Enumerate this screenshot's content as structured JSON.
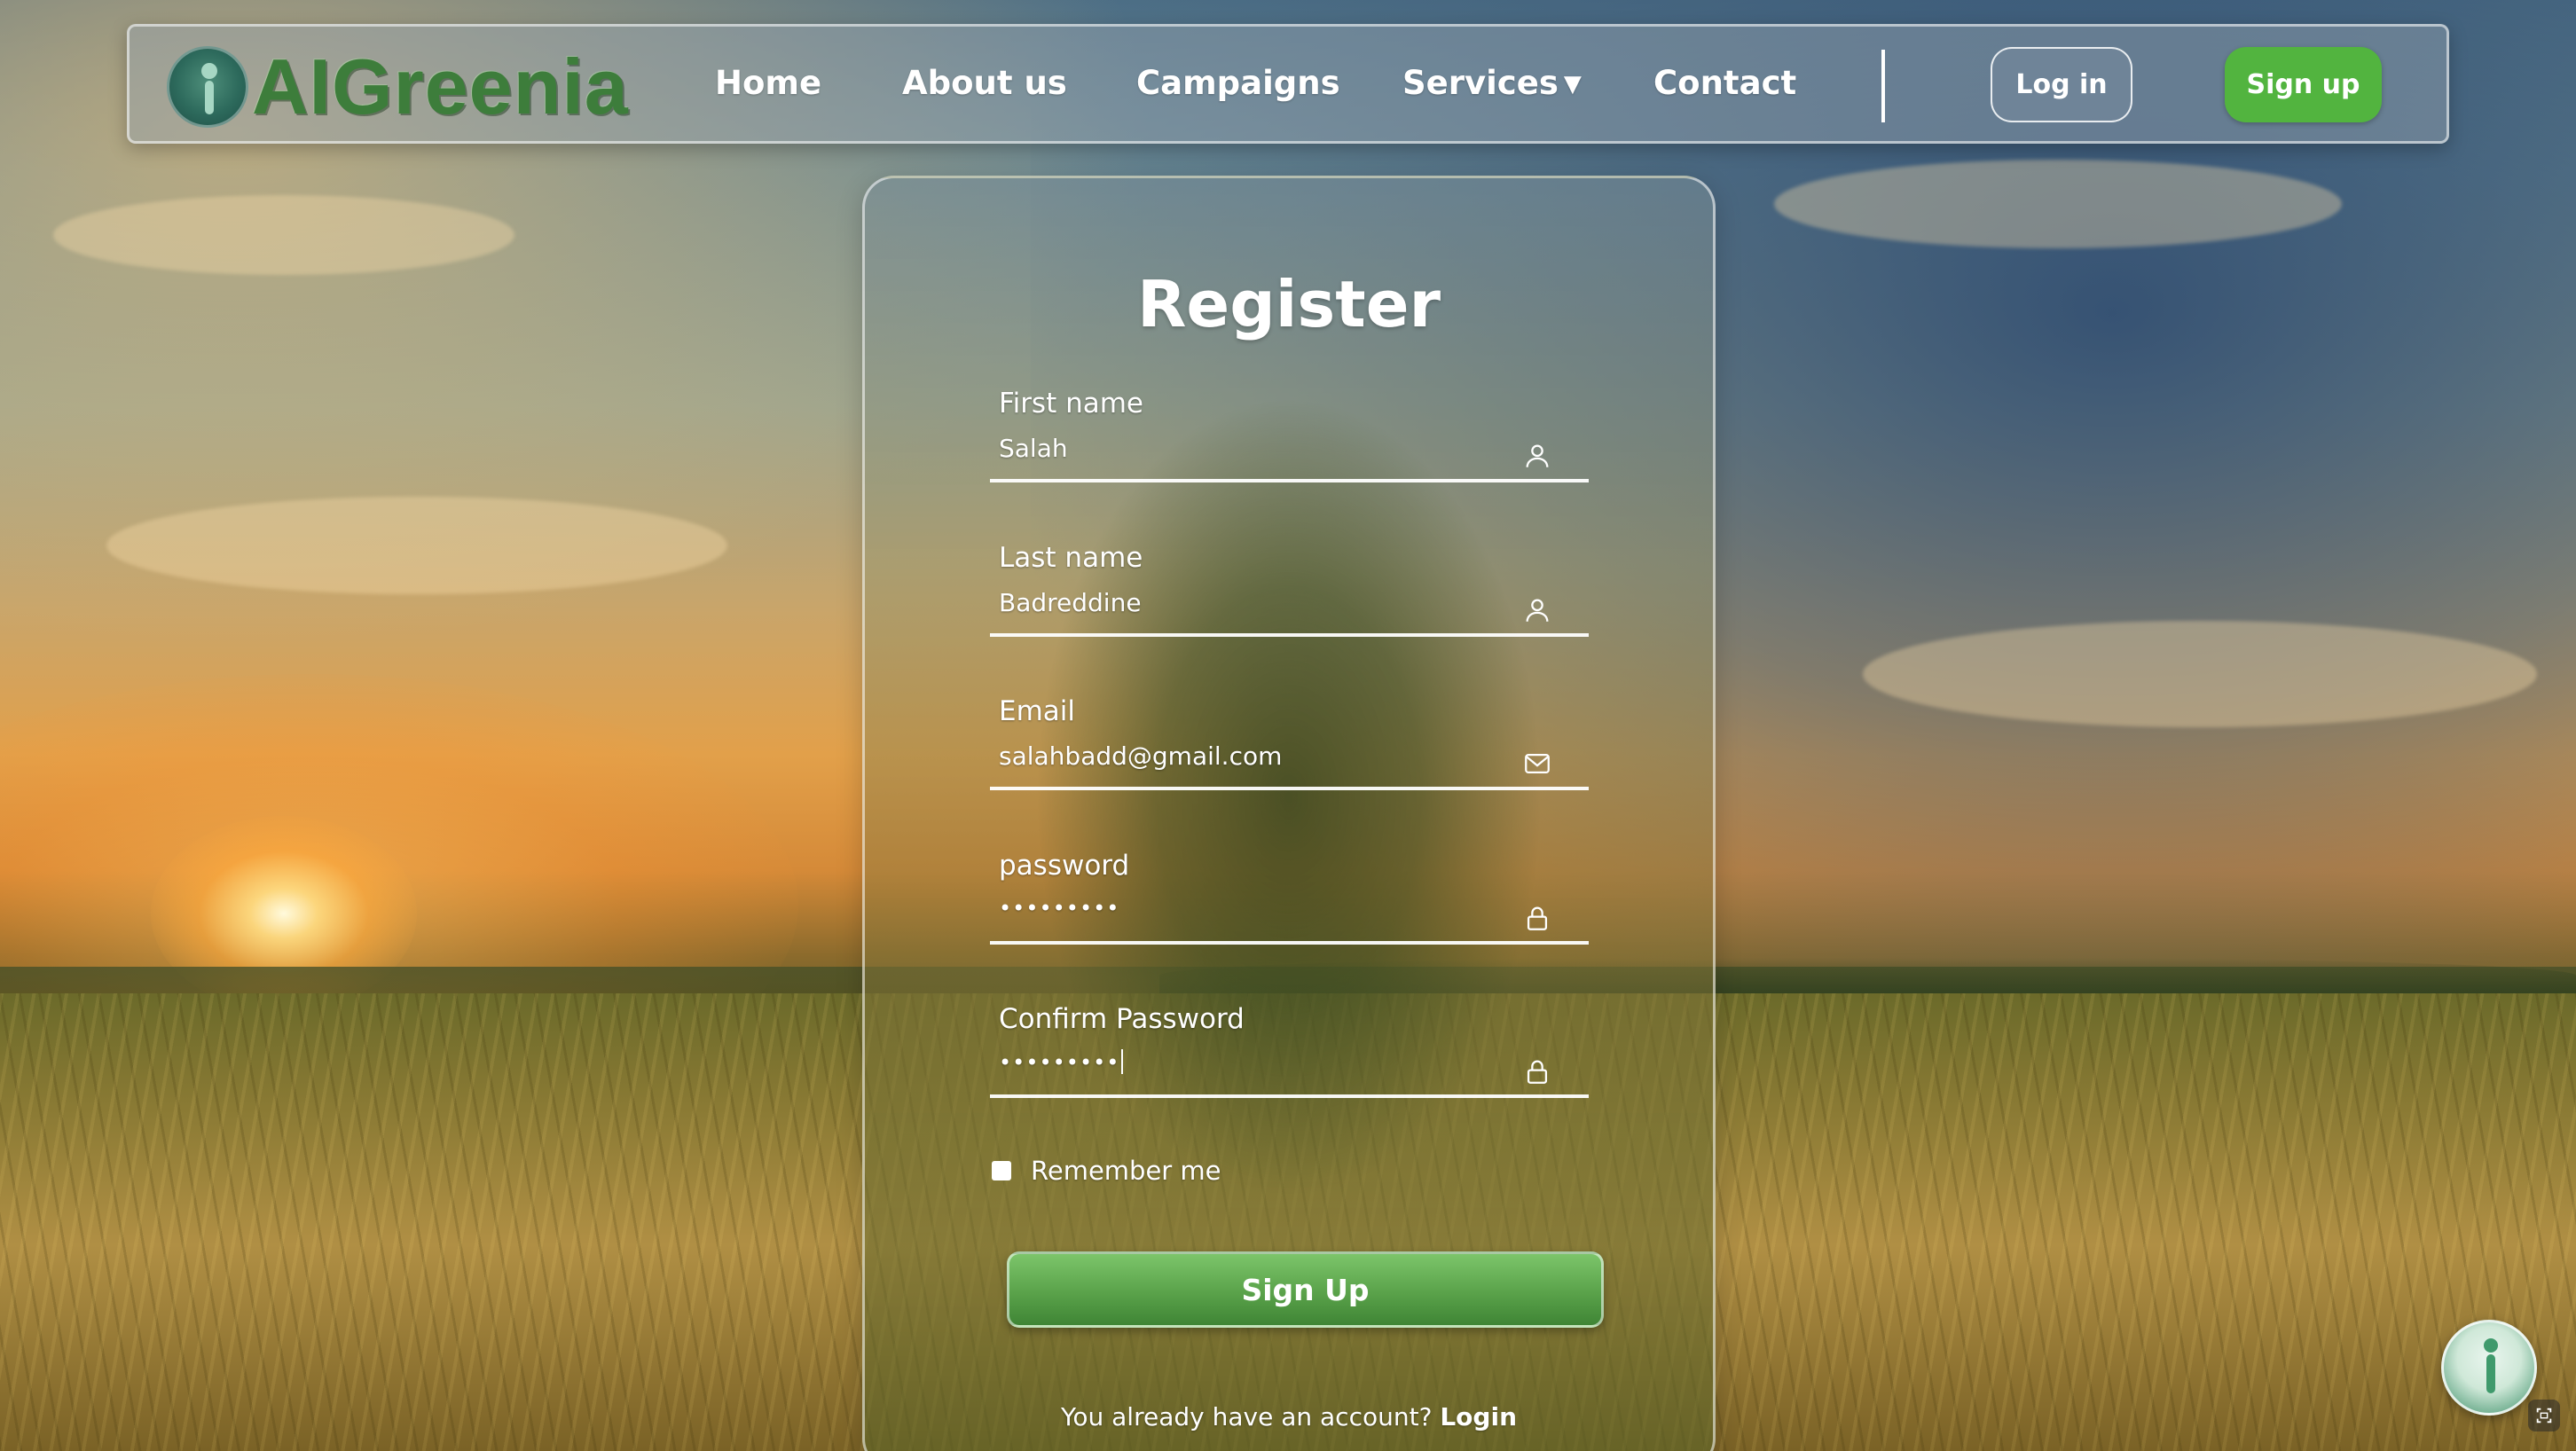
{
  "brand": {
    "name": "AIGreenia",
    "color": "#3d7d3b"
  },
  "nav": {
    "links": [
      {
        "label": "Home"
      },
      {
        "label": "About us"
      },
      {
        "label": "Campaigns"
      },
      {
        "label": "Services"
      },
      {
        "label": "Contact"
      }
    ],
    "login_label": "Log in",
    "signup_label": "Sign up",
    "signup_color": "#52b43f"
  },
  "form": {
    "title": "Register",
    "fields": [
      {
        "label": "First name",
        "value": "Salah",
        "icon": "user-icon"
      },
      {
        "label": "Last name",
        "value": "Badreddine",
        "icon": "user-icon"
      },
      {
        "label": "Email",
        "value": "salahbadd@gmail.com",
        "icon": "envelope-icon"
      },
      {
        "label": "password",
        "value": "•••••••••",
        "icon": "lock-icon"
      },
      {
        "label": "Confirm Password",
        "value": "•••••••••",
        "icon": "lock-icon"
      }
    ],
    "remember_label": "Remember me",
    "remember_checked": false,
    "submit_label": "Sign Up",
    "already_text": "You already have an account?",
    "login_link": "Login"
  }
}
